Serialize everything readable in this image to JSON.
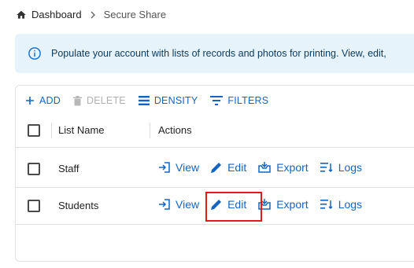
{
  "breadcrumb": {
    "home": "Dashboard",
    "current": "Secure Share"
  },
  "banner": {
    "message": "Populate your account with lists of records and photos for printing. View, edit,"
  },
  "toolbar": {
    "add_label": "ADD",
    "delete_label": "DELETE",
    "density_label": "DENSITY",
    "filters_label": "FILTERS"
  },
  "grid": {
    "columns": {
      "name": "List Name",
      "actions": "Actions"
    },
    "rows": [
      {
        "name": "Staff"
      },
      {
        "name": "Students"
      }
    ],
    "actions": {
      "view": "View",
      "edit": "Edit",
      "export": "Export",
      "logs": "Logs"
    }
  },
  "colors": {
    "accent": "#1565c0",
    "highlight": "#e01b1b",
    "banner_bg": "#e6f3fb"
  }
}
